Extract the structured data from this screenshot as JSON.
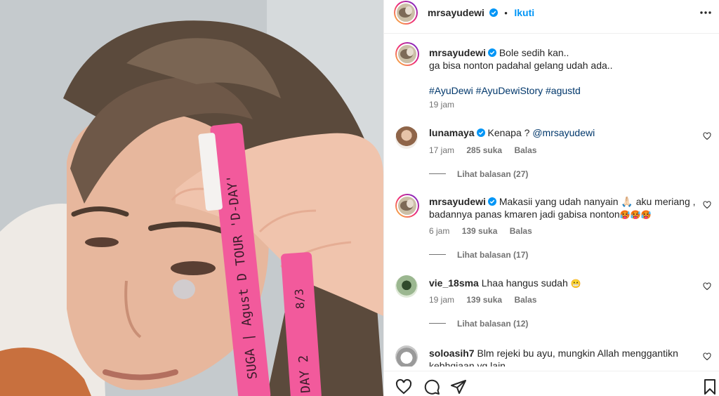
{
  "header": {
    "username": "mrsayudewi",
    "separator": "•",
    "follow_label": "Ikuti"
  },
  "caption": {
    "username": "mrsayudewi",
    "line1": "Bole sedih kan..",
    "line2": "ga bisa nonton padahal gelang udah ada..",
    "hashtags": "#AyuDewi #AyuDewiStory #agustd",
    "time": "19 jam"
  },
  "comments": [
    {
      "username": "lunamaya",
      "verified": true,
      "text": "Kenapa ? ",
      "mention": "@mrsayudewi",
      "time": "17 jam",
      "likes": "285 suka",
      "reply_label": "Balas",
      "view_replies": "Lihat balasan (27)"
    },
    {
      "username": "mrsayudewi",
      "verified": true,
      "text": "Makasii yang udah nanyain 🙏🏻 aku meriang , badannya panas kmaren jadi gabisa nonton",
      "emojis": "🥵🥵🥵",
      "time": "6 jam",
      "likes": "139 suka",
      "reply_label": "Balas",
      "view_replies": "Lihat balasan (17)"
    },
    {
      "username": "vie_18sma",
      "verified": false,
      "text": "Lhaa hangus sudah ",
      "emojis": "😬",
      "time": "19 jam",
      "likes": "139 suka",
      "reply_label": "Balas",
      "view_replies": "Lihat balasan (12)"
    },
    {
      "username": "soloasih7",
      "verified": false,
      "text": "Blm rejeki bu ayu, mungkin Allah menggantikn kebhgiaan yg lain"
    }
  ],
  "photo": {
    "wristband_text_1": "SUGA | Agust D TOUR 'D-DAY'",
    "wristband_text_2": "DAY 2",
    "wristband_text_3": "8/3"
  },
  "icons": {
    "more": "more-horizontal-icon",
    "verified": "verified-badge-icon",
    "heart": "heart-icon",
    "comment": "comment-icon",
    "share": "send-icon",
    "save": "bookmark-icon"
  },
  "colors": {
    "link_blue": "#0095f6",
    "verified_blue": "#0095f6",
    "muted": "#737373",
    "wristband_pink": "#f25a9c"
  }
}
